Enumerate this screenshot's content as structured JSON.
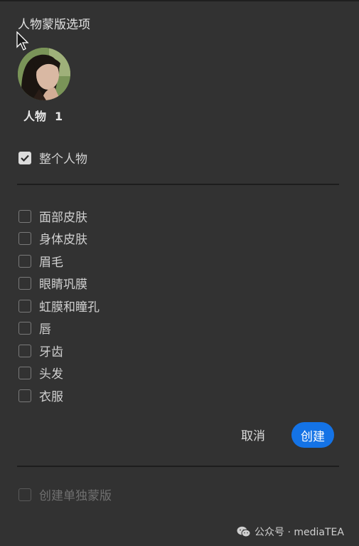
{
  "dialog": {
    "title": "人物蒙版选项",
    "person": {
      "label": "人物",
      "number": "1"
    },
    "whole_person": {
      "label": "整个人物",
      "checked": true
    },
    "parts": [
      {
        "label": "面部皮肤",
        "checked": false
      },
      {
        "label": "身体皮肤",
        "checked": false
      },
      {
        "label": "眉毛",
        "checked": false
      },
      {
        "label": "眼睛巩膜",
        "checked": false
      },
      {
        "label": "虹膜和瞳孔",
        "checked": false
      },
      {
        "label": "唇",
        "checked": false
      },
      {
        "label": "牙齿",
        "checked": false
      },
      {
        "label": "头发",
        "checked": false
      },
      {
        "label": "衣服",
        "checked": false
      }
    ],
    "buttons": {
      "cancel": "取消",
      "create": "创建"
    },
    "separate_masks": {
      "label": "创建单独蒙版",
      "checked": false,
      "disabled": true
    }
  },
  "watermark": {
    "text": "公众号 · mediaTEA",
    "icon": "wechat-icon"
  },
  "colors": {
    "background": "#323232",
    "accent": "#1473e6"
  }
}
